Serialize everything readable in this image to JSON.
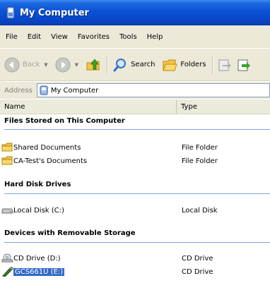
{
  "window": {
    "title": "My Computer"
  },
  "menu": [
    "File",
    "Edit",
    "View",
    "Favorites",
    "Tools",
    "Help"
  ],
  "toolbar": {
    "back": "Back",
    "search": "Search",
    "folders": "Folders"
  },
  "address": {
    "label": "Address",
    "value": "My Computer"
  },
  "columns": {
    "name": "Name",
    "type": "Type"
  },
  "groups": [
    {
      "title": "Files Stored on This Computer",
      "items": [
        {
          "name": "Shared Documents",
          "type": "File Folder",
          "icon": "folder-icon"
        },
        {
          "name": "CA-Test's Documents",
          "type": "File Folder",
          "icon": "folder-icon"
        }
      ]
    },
    {
      "title": "Hard Disk Drives",
      "items": [
        {
          "name": "Local Disk (C:)",
          "type": "Local Disk",
          "icon": "hard-disk-icon"
        }
      ]
    },
    {
      "title": "Devices with Removable Storage",
      "items": [
        {
          "name": "CD Drive (D:)",
          "type": "CD Drive",
          "icon": "cd-drive-icon"
        },
        {
          "name": "GCS661U (E:)",
          "type": "CD Drive",
          "icon": "pen-drive-icon",
          "selected": true
        }
      ]
    }
  ]
}
